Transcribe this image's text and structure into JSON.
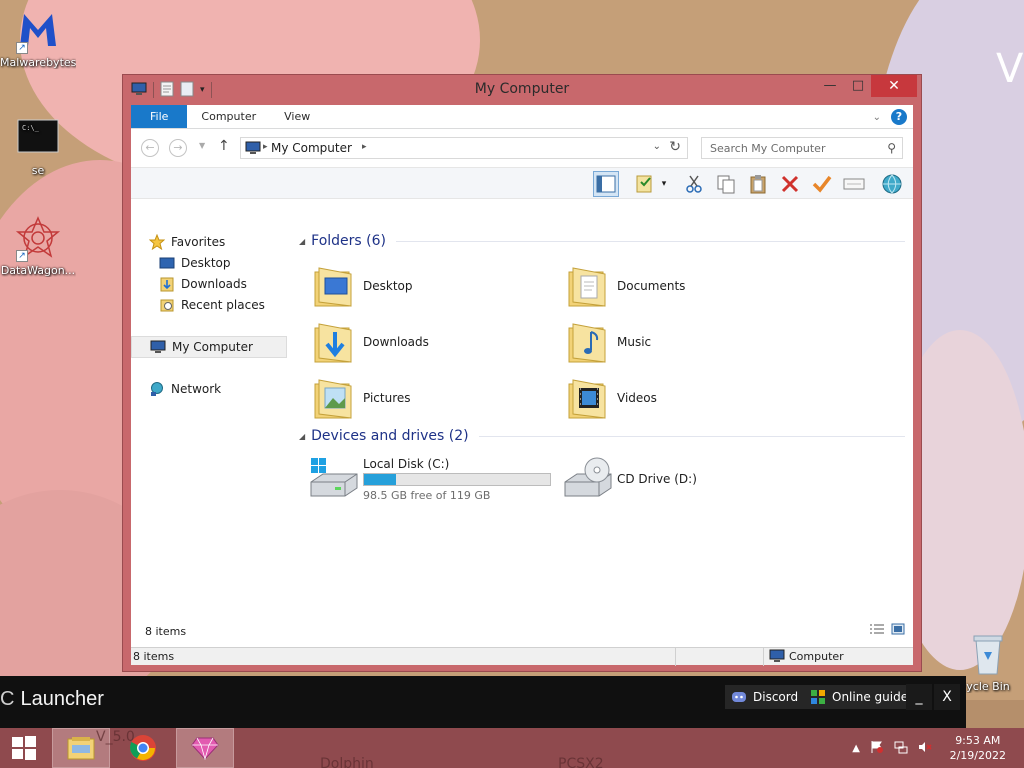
{
  "desktop": {
    "icons": [
      {
        "label": "Malwarebytes"
      },
      {
        "label": "se"
      },
      {
        "label": "DataWagon..."
      },
      {
        "label": "ycle Bin"
      }
    ],
    "console_icon_text": "C:\\_"
  },
  "window": {
    "title": "My Computer",
    "controls": {
      "minimize": "—",
      "maximize": "□",
      "close": "✕"
    }
  },
  "ribbon": {
    "tabs": [
      {
        "label": "File",
        "active": true
      },
      {
        "label": "Computer",
        "active": false
      },
      {
        "label": "View",
        "active": false
      }
    ],
    "help_label": "?"
  },
  "navbar": {
    "address_crumb": "My Computer",
    "search_placeholder": "Search My Computer"
  },
  "nav_pane": {
    "items": [
      {
        "label": "Favorites",
        "icon": "star-icon",
        "level": 0
      },
      {
        "label": "Desktop",
        "icon": "desktop-icon",
        "level": 1
      },
      {
        "label": "Downloads",
        "icon": "downloads-icon",
        "level": 1
      },
      {
        "label": "Recent places",
        "icon": "recent-places-icon",
        "level": 1
      },
      {
        "label": "My Computer",
        "icon": "computer-icon",
        "level": 0,
        "selected": true
      },
      {
        "label": "Network",
        "icon": "network-icon",
        "level": 0
      }
    ]
  },
  "content": {
    "folders_group": "Folders (6)",
    "folders": [
      {
        "name": "Desktop",
        "icon": "desktop-folder-icon"
      },
      {
        "name": "Documents",
        "icon": "documents-folder-icon"
      },
      {
        "name": "Downloads",
        "icon": "downloads-folder-icon"
      },
      {
        "name": "Music",
        "icon": "music-folder-icon"
      },
      {
        "name": "Pictures",
        "icon": "pictures-folder-icon"
      },
      {
        "name": "Videos",
        "icon": "videos-folder-icon"
      }
    ],
    "drives_group": "Devices and drives (2)",
    "drives": [
      {
        "name": "Local Disk (C:)",
        "free_text": "98.5 GB free of 119 GB",
        "used_fraction": 0.172,
        "icon": "hard-disk-icon"
      },
      {
        "name": "CD Drive (D:)",
        "icon": "cd-drive-icon"
      }
    ],
    "item_count": "8 items"
  },
  "statusbar": {
    "left": "8 items",
    "right": "Computer"
  },
  "launcher": {
    "brand_letter": "C",
    "brand": "Launcher",
    "discord": "Discord",
    "guide": "Online guide",
    "minimize": "_",
    "close": "X"
  },
  "taskbar": {
    "time": "9:53 AM",
    "date": "2/19/2022",
    "ghost_texts": [
      "V_5.0",
      "Dolphin",
      "PCSX2"
    ]
  },
  "colors": {
    "window_frame": "#c8686c",
    "accent": "#1979ca",
    "close_button": "#c7383d",
    "taskbar": "#8f4a4e",
    "disk_fill": "#26a0da"
  }
}
